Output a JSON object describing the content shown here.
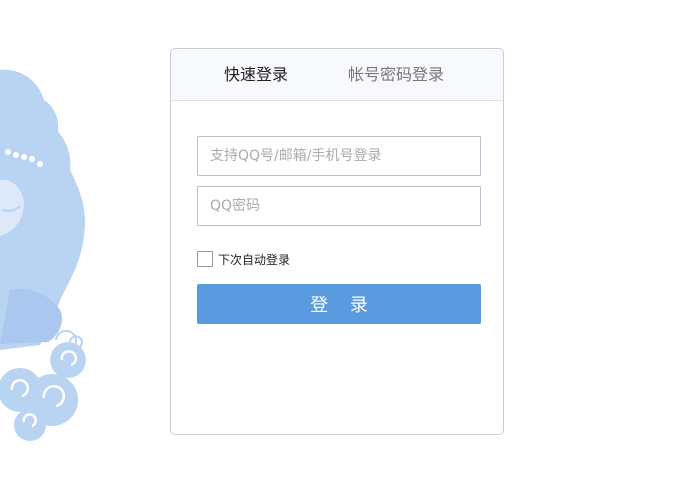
{
  "tabs": {
    "quick_login": "快速登录",
    "password_login": "帐号密码登录"
  },
  "form": {
    "account_placeholder": "支持QQ号/邮箱/手机号登录",
    "password_placeholder": "QQ密码",
    "remember_label": "下次自动登录",
    "remember_checked": false,
    "submit_label": "登 录"
  },
  "colors": {
    "accent": "#5a9be0",
    "illustration": "#b9d3f3",
    "tab_bar_bg": "#f8f9fd"
  },
  "illustration": {
    "icon": "cartoon-figure-with-clouds"
  }
}
